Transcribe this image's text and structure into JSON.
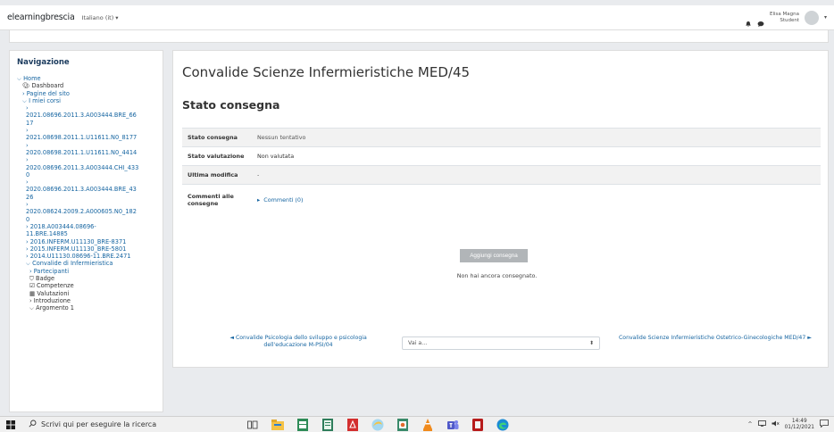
{
  "topbar": {
    "brand": "elearningbrescia",
    "language": "Italiano (it) ▾",
    "user_name": "Elisa Magna",
    "user_role": "Student",
    "caret": "▾"
  },
  "sidebar": {
    "title": "Navigazione",
    "items": [
      {
        "text": "⌵ Home",
        "level": 0
      },
      {
        "text": "Dashboard",
        "level": 1
      },
      {
        "text": "› Pagine del sito",
        "level": 1
      },
      {
        "text": "⌵ I miei corsi",
        "level": 1
      },
      {
        "text": "›",
        "level": 2
      },
      {
        "text": "2021.08696.2011.3.A003444.BRE_66",
        "level": 2
      },
      {
        "text": "17",
        "level": 2
      },
      {
        "text": "›",
        "level": 2
      },
      {
        "text": "2021.08698.2011.1.U11611.N0_8177",
        "level": 2
      },
      {
        "text": "›",
        "level": 2
      },
      {
        "text": "2020.08698.2011.1.U11611.N0_4414",
        "level": 2
      },
      {
        "text": "›",
        "level": 2
      },
      {
        "text": "2020.08696.2011.3.A003444.CHI_433",
        "level": 2
      },
      {
        "text": "0",
        "level": 2
      },
      {
        "text": "›",
        "level": 2
      },
      {
        "text": "2020.08696.2011.3.A003444.BRE_43",
        "level": 2
      },
      {
        "text": "26",
        "level": 2
      },
      {
        "text": "›",
        "level": 2
      },
      {
        "text": "2020.08624.2009.2.A000605.N0_182",
        "level": 2
      },
      {
        "text": "0",
        "level": 2
      },
      {
        "text": "› 2018.A003444.08696-",
        "level": 2
      },
      {
        "text": "11.BRE.14885",
        "level": 2
      },
      {
        "text": "› 2016.INFERM.U11130_BRE-8371",
        "level": 2
      },
      {
        "text": "› 2015.INFERM.U11130_BRE-5801",
        "level": 2
      },
      {
        "text": "› 2014.U11130.08696-11.BRE.2471",
        "level": 2
      },
      {
        "text": "⌵ Convalide di Infermieristica",
        "level": 2
      },
      {
        "text": "› Partecipanti",
        "level": 3
      },
      {
        "text": "Badge",
        "level": 3
      },
      {
        "text": "Competenze",
        "level": 3
      },
      {
        "text": "Valutazioni",
        "level": 3
      },
      {
        "text": "› Introduzione",
        "level": 3
      },
      {
        "text": "⌵ Argomento 1",
        "level": 3
      }
    ]
  },
  "main": {
    "course_title": "Convalide Scienze Infermieristiche MED/45",
    "section_title": "Stato consegna",
    "rows": [
      {
        "key": "Stato consegna",
        "value": "Nessun tentativo"
      },
      {
        "key": "Stato valutazione",
        "value": "Non valutata"
      },
      {
        "key": "Ultima modifica",
        "value": "-"
      },
      {
        "key": "Commenti alle consegne",
        "value": "Commenti (0)"
      }
    ],
    "add_button": "Aggiungi consegna",
    "not_sent": "Non hai ancora consegnato.",
    "prev_link": "◄ Convalide Psicologia dello sviluppo e psicologia dell'educazione M-PSI/04",
    "jump_label": "Vai a...",
    "jump_arrow": "⬍",
    "next_link": "Convalide Scienze Infermieristiche Ostetrico-Ginecologiche MED/47 ►"
  },
  "taskbar": {
    "search_placeholder": "Scrivi qui per eseguire la ricerca",
    "time": "14:49",
    "date": "01/12/2021"
  }
}
